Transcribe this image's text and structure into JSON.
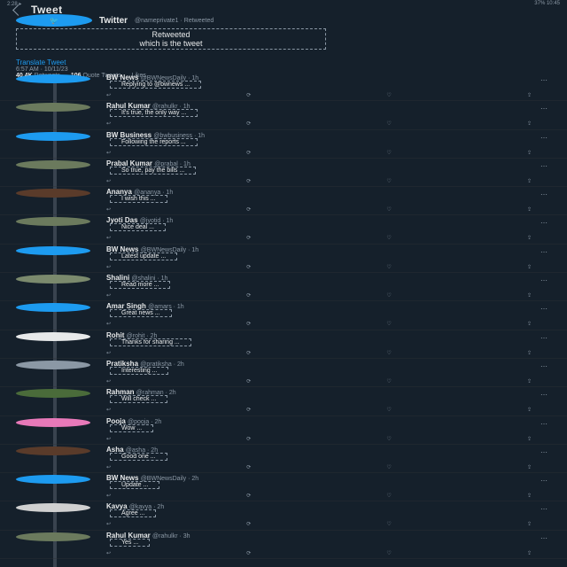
{
  "status": {
    "left": "2:28 ▸",
    "right": "37% 10:45"
  },
  "header": {
    "title": "Tweet"
  },
  "main": {
    "author": "Twitter",
    "meta": "@nameprivate1  ·  Retweeted",
    "retweet_label": "Retweeted",
    "quote_text": "which is the tweet",
    "view_link": "Translate Tweet",
    "time": "6:57 AM · 10/11/23",
    "stats": [
      {
        "value": "40.4K",
        "label": "Retweets"
      },
      {
        "value": "106",
        "label": "Quote Tweets"
      },
      {
        "value": "",
        "label": "Likes"
      }
    ]
  },
  "replies": [
    {
      "name": "BW News",
      "handle": "@BWNewsDaily · 1h",
      "text": "Replying to @bwnews ...",
      "avatar_color": "#1d9bf0"
    },
    {
      "name": "Rahul Kumar",
      "handle": "@rahulkr · 1h",
      "text": "It's true, the only way ...",
      "avatar_color": "#6b7a5d"
    },
    {
      "name": "BW Business",
      "handle": "@bwbusiness · 1h",
      "text": "Following the reports ...",
      "avatar_color": "#1d9bf0"
    },
    {
      "name": "Prabal Kumar",
      "handle": "@prabal · 1h",
      "text": "So true, pay the bills ...",
      "avatar_color": "#6b7a5d"
    },
    {
      "name": "Ananya",
      "handle": "@ananya · 1h",
      "text": "I wish this ...",
      "avatar_color": "#5a3b2a"
    },
    {
      "name": "Jyoti Das",
      "handle": "@jyotid · 1h",
      "text": "Nice deal ...",
      "avatar_color": "#6b7a5d"
    },
    {
      "name": "BW News",
      "handle": "@BWNewsDaily · 1h",
      "text": "Latest update ...",
      "avatar_color": "#1d9bf0"
    },
    {
      "name": "Shalini",
      "handle": "@shalini · 1h",
      "text": "Read more ...",
      "avatar_color": "#7b8a6d"
    },
    {
      "name": "Amar Singh",
      "handle": "@amars · 1h",
      "text": "Great news ...",
      "avatar_color": "#1d9bf0"
    },
    {
      "name": "Rohit",
      "handle": "@rohit · 2h",
      "text": "Thanks for sharing ...",
      "avatar_color": "#e7e9ea"
    },
    {
      "name": "Pratiksha",
      "handle": "@pratiksha · 2h",
      "text": "Interesting ...",
      "avatar_color": "#8b98a5"
    },
    {
      "name": "Rahman",
      "handle": "@rahman · 2h",
      "text": "Will check ...",
      "avatar_color": "#4a6b3a"
    },
    {
      "name": "Pooja",
      "handle": "@pooja · 2h",
      "text": "Wow ...",
      "avatar_color": "#e879b9"
    },
    {
      "name": "Asha",
      "handle": "@asha · 2h",
      "text": "Good one ...",
      "avatar_color": "#5a3b2a"
    },
    {
      "name": "BW News",
      "handle": "@BWNewsDaily · 2h",
      "text": "Update ...",
      "avatar_color": "#1d9bf0"
    },
    {
      "name": "Kavya",
      "handle": "@kavya · 2h",
      "text": "Agree ...",
      "avatar_color": "#d0d0d0"
    },
    {
      "name": "Rahul Kumar",
      "handle": "@rahulkr · 3h",
      "text": "Yes ...",
      "avatar_color": "#6b7a5d"
    }
  ],
  "actions": [
    "↩",
    "⟳",
    "♡",
    "⇪"
  ]
}
